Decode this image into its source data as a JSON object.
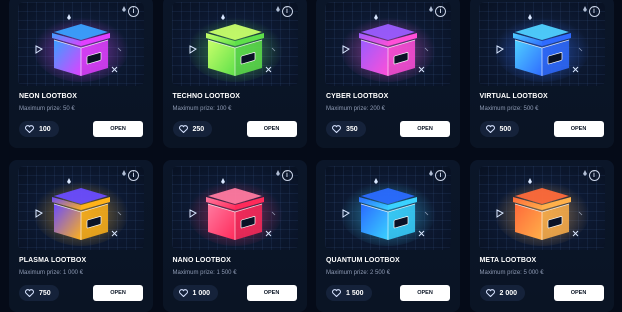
{
  "cards": [
    {
      "title": "NEON LOOTBOX",
      "prize": "Maximum prize: 50 €",
      "price": "100",
      "button": "OPEN",
      "color": "#e040ff",
      "color2": "#3aa0ff"
    },
    {
      "title": "TECHNO LOOTBOX",
      "prize": "Maximum prize: 100 €",
      "price": "250",
      "button": "OPEN",
      "color": "#5ee04a",
      "color2": "#c8ff6a"
    },
    {
      "title": "CYBER LOOTBOX",
      "prize": "Maximum prize: 200 €",
      "price": "350",
      "button": "OPEN",
      "color": "#ff4fd8",
      "color2": "#9b5cff"
    },
    {
      "title": "VIRTUAL LOOTBOX",
      "prize": "Maximum prize: 500 €",
      "price": "500",
      "button": "OPEN",
      "color": "#2f6bff",
      "color2": "#4fd0ff"
    },
    {
      "title": "PLASMA LOOTBOX",
      "prize": "Maximum prize: 1 000 €",
      "price": "750",
      "button": "OPEN",
      "color": "#ffb21a",
      "color2": "#6a4cff"
    },
    {
      "title": "NANO LOOTBOX",
      "prize": "Maximum prize: 1 500 €",
      "price": "1 000",
      "button": "OPEN",
      "color": "#ff2a5a",
      "color2": "#ff7aa0"
    },
    {
      "title": "QUANTUM LOOTBOX",
      "prize": "Maximum prize: 2 500 €",
      "price": "1 500",
      "button": "OPEN",
      "color": "#3ad2ff",
      "color2": "#2a6bff"
    },
    {
      "title": "META LOOTBOX",
      "prize": "Maximum prize: 5 000 €",
      "price": "2 000",
      "button": "OPEN",
      "color": "#ffb04a",
      "color2": "#ff6a3a"
    }
  ],
  "icons": {
    "info": "info-icon",
    "price": "heart-icon",
    "art": "lootbox-icon"
  }
}
